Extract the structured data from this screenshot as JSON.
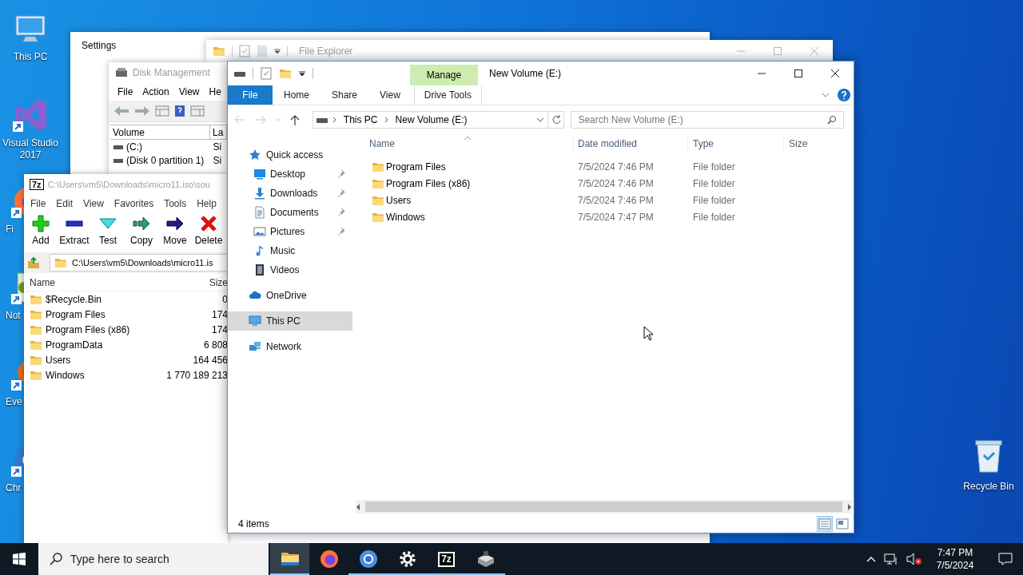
{
  "desktop_icons": [
    {
      "kind": "pc",
      "label": "This PC"
    },
    {
      "kind": "vs",
      "label": "Visual Studio 2017"
    },
    {
      "kind": "firefox",
      "label": "Fi"
    },
    {
      "kind": "notepad",
      "label": "Not"
    },
    {
      "kind": "everything",
      "label": "Eve"
    },
    {
      "kind": "chrome",
      "label": "Chr"
    }
  ],
  "recycle_bin": {
    "label": "Recycle Bin"
  },
  "settings_window": {
    "title": "Settings"
  },
  "background_explorer": {
    "title": "File Explorer"
  },
  "disk_management": {
    "title": "Disk Management",
    "menu": [
      "File",
      "Action",
      "View",
      "He"
    ],
    "columns": [
      "Volume",
      "La"
    ],
    "rows": [
      [
        "(C:)",
        "Si"
      ],
      [
        "(Disk 0 partition 1)",
        "Si"
      ]
    ]
  },
  "seven_zip": {
    "logo": "7z",
    "title": "C:\\Users\\vm5\\Downloads\\micro11.iso\\sou",
    "menu": [
      "File",
      "Edit",
      "View",
      "Favorites",
      "Tools",
      "Help"
    ],
    "tools": [
      {
        "kind": "add",
        "label": "Add"
      },
      {
        "kind": "extract",
        "label": "Extract"
      },
      {
        "kind": "test",
        "label": "Test"
      },
      {
        "kind": "copy",
        "label": "Copy"
      },
      {
        "kind": "move",
        "label": "Move"
      },
      {
        "kind": "delete",
        "label": "Delete"
      }
    ],
    "address": "C:\\Users\\vm5\\Downloads\\micro11.is",
    "columns": [
      "Name",
      "Size"
    ],
    "rows": [
      {
        "name": "$Recycle.Bin",
        "size": "0"
      },
      {
        "name": "Program Files",
        "size": "174"
      },
      {
        "name": "Program Files (x86)",
        "size": "174"
      },
      {
        "name": "ProgramData",
        "size": "6 808"
      },
      {
        "name": "Users",
        "size": "164 456"
      },
      {
        "name": "Windows",
        "size": "1 770 189 213"
      }
    ]
  },
  "explorer": {
    "title": "New Volume (E:)",
    "context_group": "Manage",
    "tabs": [
      {
        "kind": "file",
        "label": "File"
      },
      {
        "kind": "tab",
        "label": "Home"
      },
      {
        "kind": "tab",
        "label": "Share"
      },
      {
        "kind": "tab",
        "label": "View"
      },
      {
        "kind": "context",
        "label": "Drive Tools"
      }
    ],
    "breadcrumb": [
      "This PC",
      "New Volume (E:)"
    ],
    "search": {
      "placeholder": "Search New Volume (E:)"
    },
    "nav": [
      {
        "kind": "star",
        "label": "Quick access",
        "selected": false,
        "children": [
          {
            "kind": "desktop",
            "label": "Desktop",
            "pinned": true,
            "selected": false
          },
          {
            "kind": "downloads",
            "label": "Downloads",
            "pinned": true,
            "selected": false
          },
          {
            "kind": "documents",
            "label": "Documents",
            "pinned": true,
            "selected": false
          },
          {
            "kind": "pictures",
            "label": "Pictures",
            "pinned": true,
            "selected": false
          },
          {
            "kind": "music",
            "label": "Music",
            "pinned": false,
            "selected": false
          },
          {
            "kind": "videos",
            "label": "Videos",
            "pinned": false,
            "selected": false
          }
        ]
      },
      {
        "kind": "cloud",
        "label": "OneDrive",
        "selected": false
      },
      {
        "kind": "pc",
        "label": "This PC",
        "selected": true
      },
      {
        "kind": "network",
        "label": "Network",
        "selected": false
      }
    ],
    "columns": [
      "Name",
      "Date modified",
      "Type",
      "Size"
    ],
    "rows": [
      {
        "name": "Program Files",
        "date": "7/5/2024 7:46 PM",
        "type": "File folder"
      },
      {
        "name": "Program Files (x86)",
        "date": "7/5/2024 7:46 PM",
        "type": "File folder"
      },
      {
        "name": "Users",
        "date": "7/5/2024 7:46 PM",
        "type": "File folder"
      },
      {
        "name": "Windows",
        "date": "7/5/2024 7:47 PM",
        "type": "File folder"
      }
    ],
    "status": "4 items",
    "views": [
      {
        "kind": "details",
        "selected": true
      },
      {
        "kind": "tiles",
        "selected": false
      }
    ]
  },
  "taskbar": {
    "search_placeholder": "Type here to search",
    "apps": [
      {
        "kind": "explorer",
        "open": true,
        "selected": true
      },
      {
        "kind": "firefox",
        "open": false,
        "selected": false
      },
      {
        "kind": "chrome",
        "open": true,
        "selected": false
      },
      {
        "kind": "settings",
        "open": true,
        "selected": false
      },
      {
        "kind": "sevenzip",
        "logo": "7z",
        "open": true,
        "selected": false
      },
      {
        "kind": "diskmgmt",
        "open": true,
        "selected": false
      }
    ],
    "time": "7:47 PM",
    "date": "7/5/2024"
  }
}
